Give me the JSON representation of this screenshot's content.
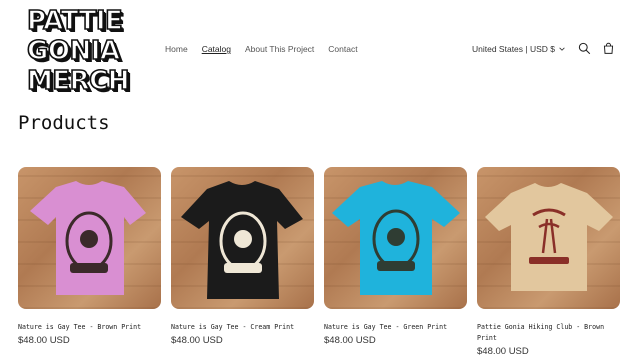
{
  "brand": {
    "logo_lines": [
      "PATTIE",
      "GONIA",
      "MERCH"
    ]
  },
  "nav": {
    "items": [
      "Home",
      "Catalog",
      "About This Project",
      "Contact"
    ],
    "active": "Catalog"
  },
  "header": {
    "locale": "United States | USD $"
  },
  "icons": [
    "search-icon",
    "cart-icon",
    "chevron-down-icon"
  ],
  "page": {
    "title": "Products"
  },
  "products": [
    {
      "title": "Nature is Gay Tee - Brown Print",
      "price": "$48.00 USD",
      "shirt_color": "#d98fd2",
      "print_color": "#3b2a2a"
    },
    {
      "title": "Nature is Gay Tee - Cream Print",
      "price": "$48.00 USD",
      "shirt_color": "#1b1b1b",
      "print_color": "#efe7d6"
    },
    {
      "title": "Nature is Gay Tee - Green Print",
      "price": "$48.00 USD",
      "shirt_color": "#1fb3dc",
      "print_color": "#2f3d33"
    },
    {
      "title": "Pattie Gonia Hiking Club - Brown Print",
      "price": "$48.00 USD",
      "shirt_color": "#e2c79e",
      "print_color": "#8a2f28"
    }
  ]
}
